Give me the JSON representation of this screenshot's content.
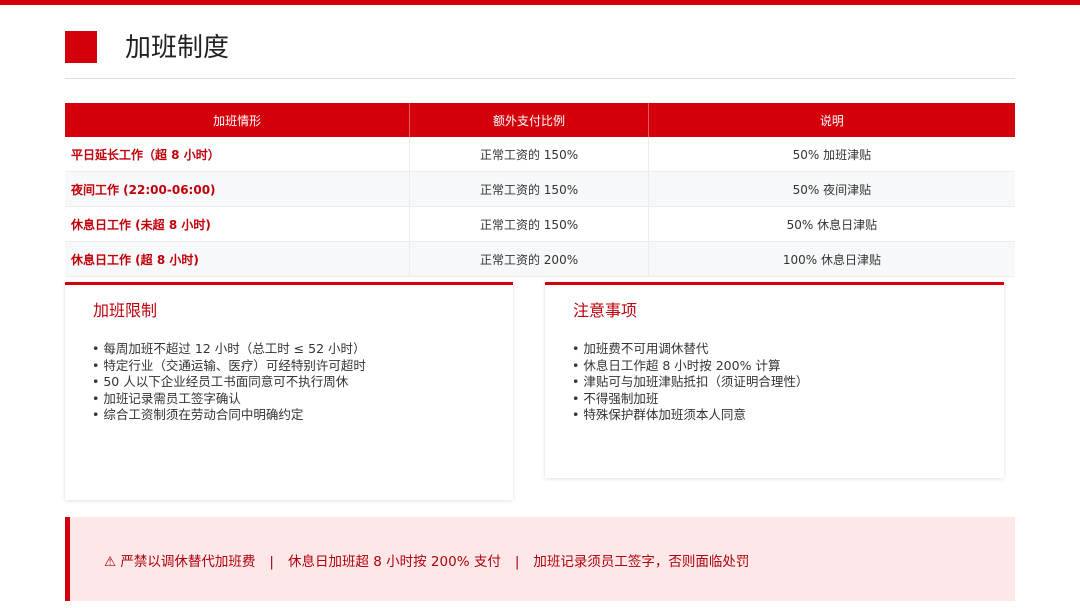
{
  "header": {
    "title": "加班制度"
  },
  "table": {
    "headers": [
      "加班情形",
      "额外支付比例",
      "说明"
    ],
    "rows": [
      [
        "平日延长工作（超 8 小时）",
        "正常工资的 150%",
        "50% 加班津贴"
      ],
      [
        "夜间工作 (22:00-06:00)",
        "正常工资的 150%",
        "50% 夜间津贴"
      ],
      [
        "休息日工作 (未超 8 小时)",
        "正常工资的 150%",
        "50% 休息日津贴"
      ],
      [
        "休息日工作 (超 8 小时)",
        "正常工资的 200%",
        "100% 休息日津贴"
      ]
    ]
  },
  "limits": {
    "title": "加班限制",
    "items": [
      "每周加班不超过 12 小时（总工时 ≤ 52 小时）",
      "特定行业（交通运输、医疗）可经特别许可超时",
      "50 人以下企业经员工书面同意可不执行周休",
      "加班记录需员工签字确认",
      "综合工资制须在劳动合同中明确约定"
    ]
  },
  "notes": {
    "title": "注意事项",
    "items": [
      "加班费不可用调休替代",
      "休息日工作超 8 小时按 200% 计算",
      "津贴可与加班津贴抵扣（须证明合理性）",
      "不得强制加班",
      "特殊保护群体加班须本人同意"
    ]
  },
  "banner": {
    "warning_icon": "warning-icon",
    "parts": [
      "⚠ 严禁以调休替代加班费",
      "休息日加班超 8 小时按 200% 支付",
      "加班记录须员工签字，否则面临处罚"
    ],
    "separator": "|"
  },
  "colors": {
    "accent": "#d3000b",
    "banner_bg": "#fde7e8"
  }
}
